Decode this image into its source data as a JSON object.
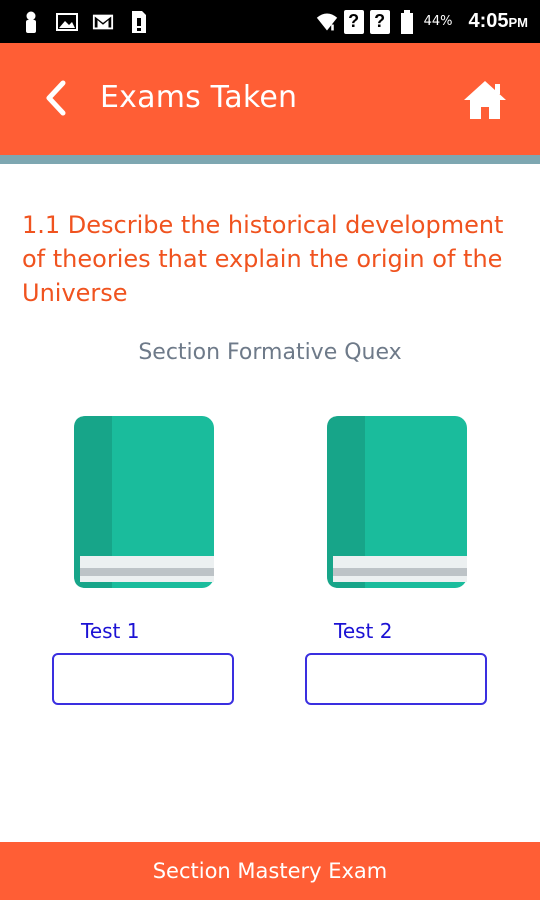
{
  "status_bar": {
    "icons": [
      "person-icon",
      "gallery-icon",
      "gmail-icon",
      "sim-icon",
      "wifi-icon",
      "unknown-network-icon",
      "unknown-network-icon",
      "battery-icon"
    ],
    "q1": "?",
    "q2": "?",
    "battery_percent": "44%",
    "time": "4:05",
    "ampm": "PM"
  },
  "header": {
    "title": "Exams Taken",
    "back_icon": "chevron-left-icon",
    "home_icon": "home-icon",
    "color": "#ff5e35",
    "strip_color": "#7ea7b1"
  },
  "main": {
    "objective": "1.1 Describe the historical development of theories that explain the origin of the Universe",
    "section_label": "Section Formative Quex",
    "tests": [
      {
        "label": "Test  1",
        "icon": "book-icon",
        "score": ""
      },
      {
        "label": "Test  2",
        "icon": "book-icon",
        "score": ""
      }
    ]
  },
  "footer": {
    "button_label": "Section Mastery Exam"
  },
  "colors": {
    "accent": "#ff5e35",
    "objective_text": "#f0531f",
    "test_label": "#1c12d4",
    "book": "#1abc9c"
  }
}
